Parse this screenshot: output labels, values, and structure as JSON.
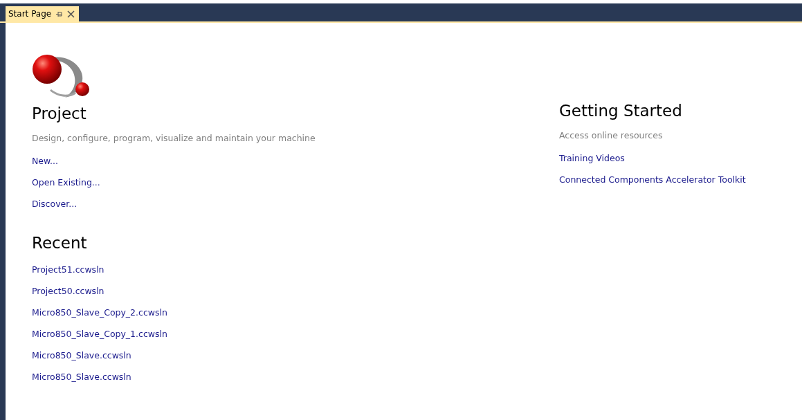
{
  "tabs": [
    {
      "label": "Start Page",
      "selected": true
    }
  ],
  "project": {
    "heading": "Project",
    "description": "Design, configure, program, visualize and maintain your machine",
    "links": [
      "New...",
      "Open Existing...",
      "Discover..."
    ]
  },
  "recent": {
    "heading": "Recent",
    "items": [
      "Project51.ccwsln",
      "Project50.ccwsln",
      "Micro850_Slave_Copy_2.ccwsln",
      "Micro850_Slave_Copy_1.ccwsln",
      "Micro850_Slave.ccwsln",
      "Micro850_Slave.ccwsln"
    ]
  },
  "getting_started": {
    "heading": "Getting Started",
    "description": "Access online resources",
    "links": [
      "Training Videos",
      "Connected Components Accelerator Toolkit"
    ]
  }
}
